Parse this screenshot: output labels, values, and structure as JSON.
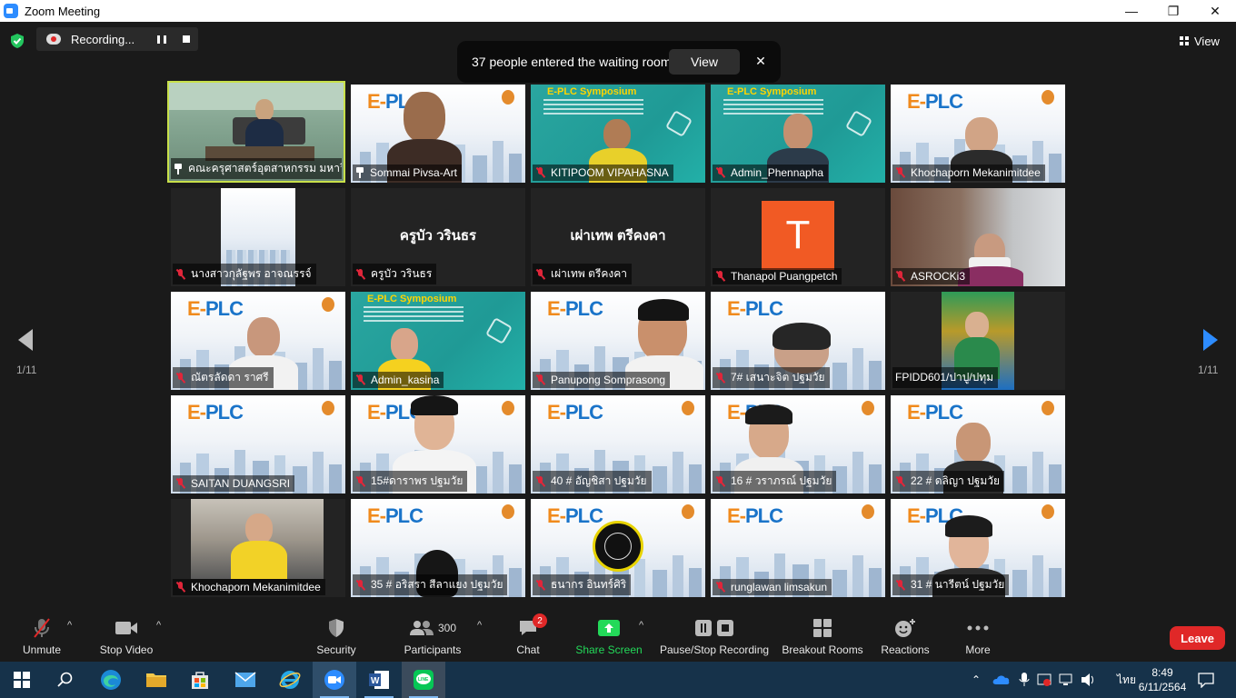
{
  "window": {
    "title": "Zoom Meeting",
    "minimize": "—",
    "maximize": "❐",
    "close": "✕"
  },
  "recording": {
    "label": "Recording..."
  },
  "waiting_room": {
    "message": "37 people entered the waiting room",
    "view_label": "View",
    "close_label": "✕"
  },
  "view_button": {
    "label": "View"
  },
  "pagination": {
    "left": "1/11",
    "right": "1/11"
  },
  "tiles": [
    {
      "name": "คณะครุศาสตร์อุตสาหกรรม มหาวิ...",
      "icon": "pin"
    },
    {
      "name": "Sommai Pivsa-Art",
      "icon": "pin"
    },
    {
      "name": "KITIPOOM VIPAHASNA",
      "icon": "mic-off"
    },
    {
      "name": "Admin_Phennapha",
      "icon": "mic-off"
    },
    {
      "name": "Khochaporn Mekanimitdee",
      "icon": "mic-off"
    },
    {
      "name": "นางสาวกุลัฐพร อาจณรรจ์",
      "icon": "mic-off"
    },
    {
      "name": "ครูบัว วรินธร",
      "icon": "mic-off",
      "display": "ครูบัว วรินธร"
    },
    {
      "name": "เผ่าเทพ  ตรีคงคา",
      "icon": "mic-off",
      "display": "เผ่าเทพ  ตรีคงคา"
    },
    {
      "name": "Thanapol Puangpetch",
      "icon": "mic-off",
      "avatar": "T"
    },
    {
      "name": "ASROCKi3",
      "icon": "mic-off"
    },
    {
      "name": "ณัตรลัดดา ราศรี",
      "icon": "mic-off"
    },
    {
      "name": "Admin_kasina",
      "icon": "mic-off"
    },
    {
      "name": "Panupong Somprasong",
      "icon": "mic-off"
    },
    {
      "name": "7# เสนาะจิต ปฐมวัย",
      "icon": "mic-off"
    },
    {
      "name": "FPIDD601/ปาปู/ปทุม",
      "icon": "none"
    },
    {
      "name": "SAITAN DUANGSRI",
      "icon": "mic-off"
    },
    {
      "name": "15#ดาราพร ปฐมวัย",
      "icon": "mic-off"
    },
    {
      "name": "40 # อัญชิสา ปฐมวัย",
      "icon": "mic-off"
    },
    {
      "name": "16 # วราภรณ์ ปฐมวัย",
      "icon": "mic-off"
    },
    {
      "name": "22 # ดลิญา  ปฐมวัย",
      "icon": "mic-off"
    },
    {
      "name": "Khochaporn Mekanimitdee",
      "icon": "mic-off"
    },
    {
      "name": "35 # อริสรา สีลาแยง ปฐมวัย",
      "icon": "mic-off"
    },
    {
      "name": "ธนากร อินทร์ศิริ",
      "icon": "mic-off"
    },
    {
      "name": "runglawan limsakun",
      "icon": "mic-off"
    },
    {
      "name": "31 # นารีตน์ ปฐมวัย",
      "icon": "mic-off"
    }
  ],
  "backgrounds": {
    "plc_logo_left": "E-",
    "plc_logo_right": "PLC",
    "symposium": "E-PLC Symposium"
  },
  "toolbar": {
    "unmute": "Unmute",
    "stop_video": "Stop Video",
    "security": "Security",
    "participants": "Participants",
    "participants_count": "300",
    "chat": "Chat",
    "chat_badge": "2",
    "share_screen": "Share Screen",
    "pause_stop_recording": "Pause/Stop Recording",
    "breakout_rooms": "Breakout Rooms",
    "reactions": "Reactions",
    "more": "More",
    "leave": "Leave"
  },
  "taskbar": {
    "language": "ไทย",
    "time": "8:49",
    "date": "6/11/2564"
  },
  "colors": {
    "accent": "#2d8cff",
    "leave": "#e02828",
    "share": "#23d959",
    "active_border": "#c8e04a"
  }
}
